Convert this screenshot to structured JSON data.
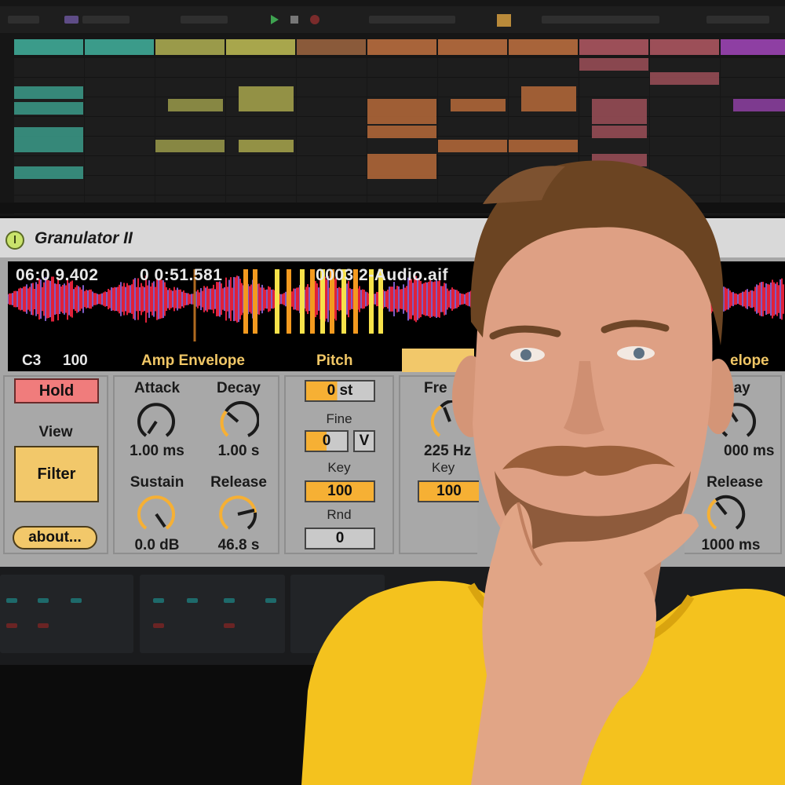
{
  "colors": {
    "accent_yellow": "#f2c86a",
    "hold_red": "#f07c7c",
    "orange_field": "#f6b034",
    "wave_red": "#e0213a",
    "wave_purple": "#7c5cc4",
    "grain_orange": "#f39a1f",
    "grain_yellow": "#f7e24a",
    "shirt_yellow": "#f4c21e"
  },
  "plugin": {
    "title": "Granulator II",
    "display": {
      "time_left": "06:0 9.402",
      "time_right": "0 0:51.581",
      "file_name": "0003 2-Audio.aif",
      "note": "C3",
      "velocity": "100"
    },
    "sections": {
      "amp_envelope": "Amp Envelope",
      "pitch": "Pitch",
      "filter_envelope": "elope"
    },
    "left_panel": {
      "hold_label": "Hold",
      "view_label": "View",
      "filter_label": "Filter",
      "about_label": "about..."
    },
    "amp": {
      "attack_label": "Attack",
      "attack_value": "1.00 ms",
      "decay_label": "Decay",
      "decay_value": "1.00 s",
      "sustain_label": "Sustain",
      "sustain_value": "0.0 dB",
      "release_label": "Release",
      "release_value": "46.8 s"
    },
    "pitch": {
      "semitone_value": "0 st",
      "fine_label": "Fine",
      "fine_value": "0",
      "v_label": "V",
      "key_label": "Key",
      "key_value": "100",
      "rnd_label": "Rnd",
      "rnd_value": "0"
    },
    "filter": {
      "freq_label": "Fre",
      "freq_value": "225 Hz",
      "key_label": "Key",
      "key_value": "100"
    },
    "filter_env": {
      "decay_label": "cay",
      "decay_value": "000 ms",
      "release_label": "Release",
      "release_value": "1000 ms"
    }
  }
}
